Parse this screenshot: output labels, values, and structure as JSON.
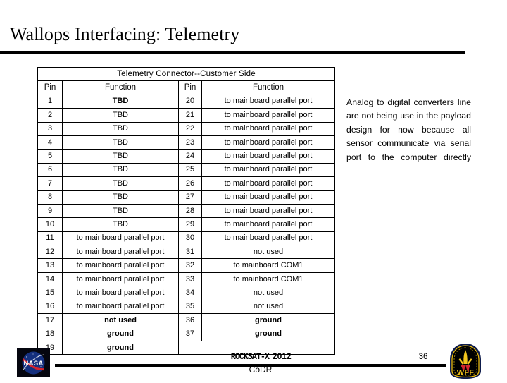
{
  "slide": {
    "title": "Wallops Interfacing: Telemetry",
    "page_number": "36"
  },
  "table": {
    "caption": "Telemetry Connector--Customer Side",
    "headers": [
      "Pin",
      "Function",
      "Pin",
      "Function"
    ],
    "rows": [
      {
        "pin_l": "1",
        "fn_l": "TBD",
        "fn_l_bold": true,
        "pin_r": "20",
        "fn_r": "to mainboard parallel port"
      },
      {
        "pin_l": "2",
        "fn_l": "TBD",
        "fn_l_bold": false,
        "pin_r": "21",
        "fn_r": "to mainboard parallel port"
      },
      {
        "pin_l": "3",
        "fn_l": "TBD",
        "fn_l_bold": false,
        "pin_r": "22",
        "fn_r": "to mainboard parallel port"
      },
      {
        "pin_l": "4",
        "fn_l": "TBD",
        "fn_l_bold": false,
        "pin_r": "23",
        "fn_r": "to mainboard parallel port"
      },
      {
        "pin_l": "5",
        "fn_l": "TBD",
        "fn_l_bold": false,
        "pin_r": "24",
        "fn_r": "to mainboard parallel port"
      },
      {
        "pin_l": "6",
        "fn_l": "TBD",
        "fn_l_bold": false,
        "pin_r": "25",
        "fn_r": "to mainboard parallel port"
      },
      {
        "pin_l": "7",
        "fn_l": "TBD",
        "fn_l_bold": false,
        "pin_r": "26",
        "fn_r": "to mainboard parallel port"
      },
      {
        "pin_l": "8",
        "fn_l": "TBD",
        "fn_l_bold": false,
        "pin_r": "27",
        "fn_r": "to mainboard parallel port"
      },
      {
        "pin_l": "9",
        "fn_l": "TBD",
        "fn_l_bold": false,
        "pin_r": "28",
        "fn_r": "to mainboard parallel port"
      },
      {
        "pin_l": "10",
        "fn_l": "TBD",
        "fn_l_bold": false,
        "pin_r": "29",
        "fn_r": "to mainboard parallel port"
      },
      {
        "pin_l": "11",
        "fn_l": "to mainboard parallel port",
        "fn_l_bold": false,
        "pin_r": "30",
        "fn_r": "to mainboard parallel port"
      },
      {
        "pin_l": "12",
        "fn_l": "to mainboard parallel port",
        "fn_l_bold": false,
        "pin_r": "31",
        "fn_r": "not used"
      },
      {
        "pin_l": "13",
        "fn_l": "to mainboard parallel port",
        "fn_l_bold": false,
        "pin_r": "32",
        "fn_r": "to mainboard COM1"
      },
      {
        "pin_l": "14",
        "fn_l": "to mainboard parallel port",
        "fn_l_bold": false,
        "pin_r": "33",
        "fn_r": "to mainboard COM1"
      },
      {
        "pin_l": "15",
        "fn_l": "to mainboard parallel port",
        "fn_l_bold": false,
        "pin_r": "34",
        "fn_r": "not used"
      },
      {
        "pin_l": "16",
        "fn_l": "to mainboard parallel port",
        "fn_l_bold": false,
        "pin_r": "35",
        "fn_r": "not used"
      },
      {
        "pin_l": "17",
        "fn_l": "not used",
        "fn_l_bold": true,
        "pin_r": "36",
        "fn_r": "ground",
        "fn_r_bold": true
      },
      {
        "pin_l": "18",
        "fn_l": "ground",
        "fn_l_bold": true,
        "pin_r": "37",
        "fn_r": "ground",
        "fn_r_bold": true
      },
      {
        "pin_l": "19",
        "fn_l": "ground",
        "fn_l_bold": true,
        "pin_r": "",
        "fn_r": "",
        "blackout": true
      }
    ]
  },
  "side_note": {
    "text": "Analog to digital converters line are not being use in the payload design for now because all sensor communicate via serial port to the computer directly"
  },
  "footer": {
    "rocksat_logo": "ROCKSAT-X",
    "year": "2012",
    "review": "CoDR",
    "nasa_wordmark": "NASA",
    "wff_wordmark": "WFF"
  },
  "colors": {
    "header_band": "#b0b0b0",
    "rule": "#000000",
    "nasa_blue": "#1a3a8f",
    "nasa_red": "#d22b2b",
    "wff_gold": "#f2c41d",
    "wff_navy": "#0d1b4c"
  }
}
